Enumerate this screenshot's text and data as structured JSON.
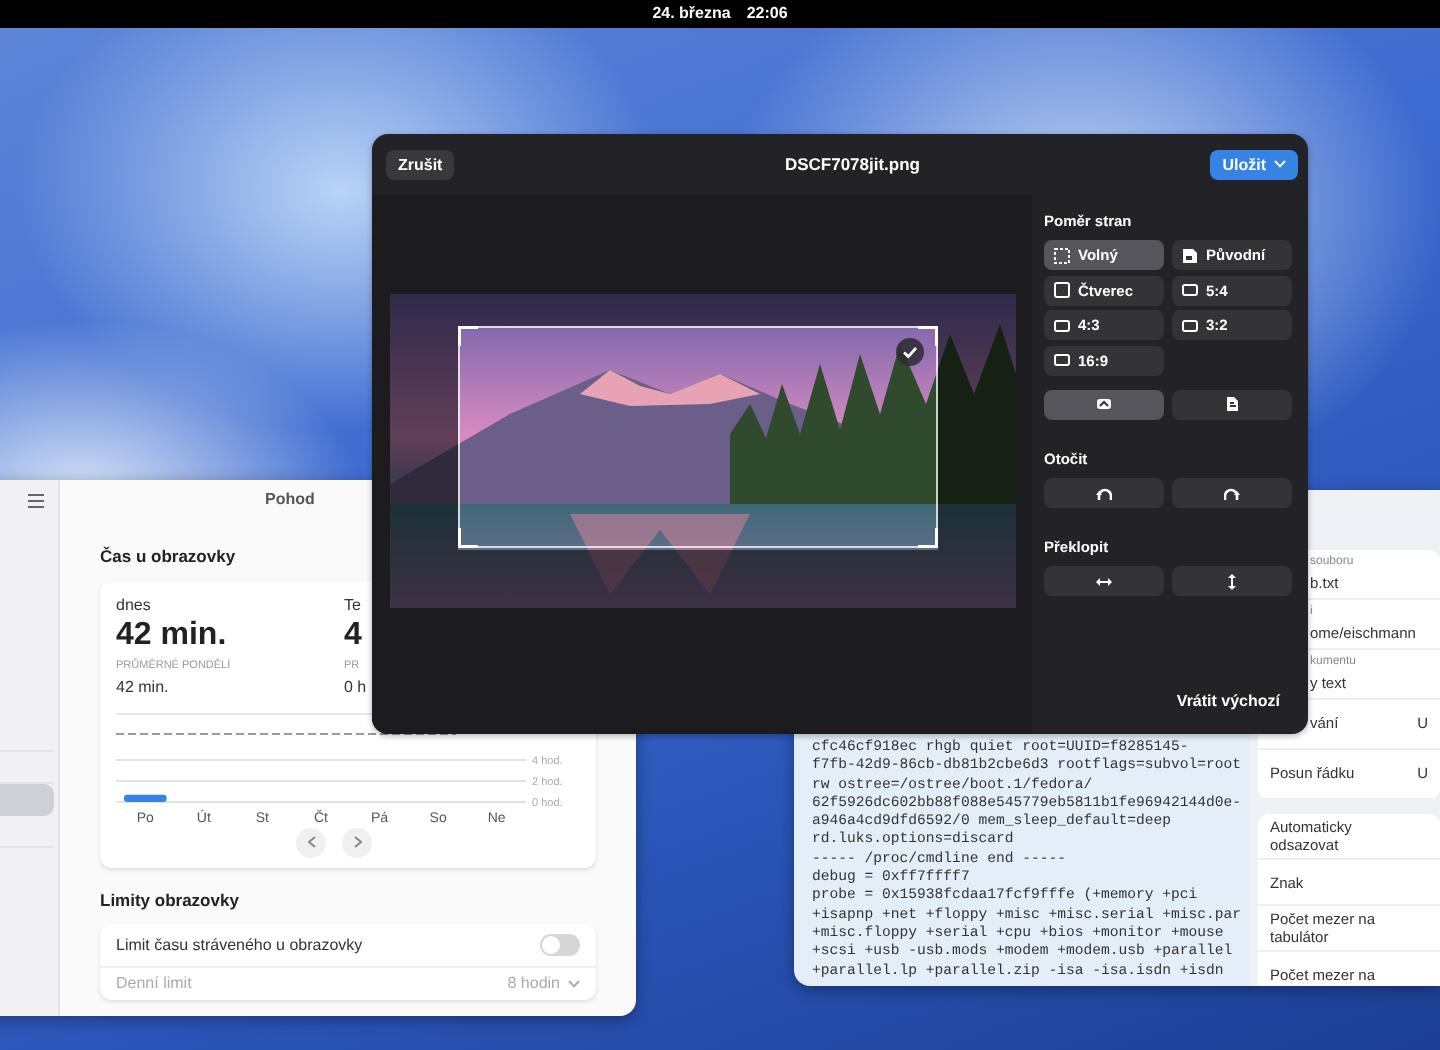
{
  "top_bar": {
    "date": "24. března",
    "time": "22:06"
  },
  "wellbeing_window": {
    "title": "Pohod",
    "sidebar_items": [
      {
        "selected": false
      },
      {
        "selected": false
      },
      {
        "selected": true
      },
      {
        "selected": false
      }
    ],
    "screen_time": {
      "heading": "Čas u obrazovky",
      "today_label": "dnes",
      "today_value": "42 min.",
      "avg_label": "PRŮMĚRNÉ PONDĚLÍ",
      "avg_value": "42 min.",
      "week_label": "Te",
      "week_value": "4",
      "week_avg_label": "PR",
      "week_avg_value": "0 h",
      "chart_data": {
        "type": "bar",
        "categories": [
          "Po",
          "Út",
          "St",
          "Čt",
          "Pá",
          "So",
          "Ne"
        ],
        "values": [
          0.7,
          0,
          0,
          0,
          0,
          0,
          0
        ],
        "ylim": [
          0,
          4
        ],
        "yticks": [
          {
            "value": 4,
            "label": "4 hod."
          },
          {
            "value": 2,
            "label": "2 hod."
          },
          {
            "value": 0,
            "label": "0 hod."
          }
        ]
      }
    },
    "limits": {
      "heading": "Limity obrazovky",
      "toggle_label": "Limit času stráveného u obrazovky",
      "toggle_on": false,
      "daily_label": "Denní limit",
      "daily_value": "8 hodin"
    }
  },
  "editor_window": {
    "text_lines": [
      "cfc46cf918ec rhgb quiet root=UUID=f8285145-",
      "f7fb-42d9-86cb-db81b2cbe6d3 rootflags=subvol=root",
      "rw ostree=/ostree/boot.1/fedora/",
      "62f5926dc602bb88f088e545779eb5811b1fe96942144d0e-",
      "a946a4cd9dfd6592/0 mem_sleep_default=deep",
      "rd.luks.options=discard",
      "----- /proc/cmdline end -----",
      "debug = 0xff7ffff7",
      "probe = 0x15938fcdaa17fcf9fffe (+memory +pci",
      "+isapnp +net +floppy +misc +misc.serial +misc.par",
      "+misc.floppy +serial +cpu +bios +monitor +mouse",
      "+scsi +usb -usb.mods +modem +modem.usb +parallel",
      "+parallel.lp +parallel.zip -isa -isa.isdn +isdn"
    ],
    "info": [
      {
        "kind": "field",
        "label": "souboru",
        "value": "b.txt"
      },
      {
        "kind": "field",
        "label": "i",
        "value": "ome/eischmann"
      },
      {
        "kind": "field",
        "label": "kumentu",
        "value": "y text"
      },
      {
        "kind": "row",
        "label": "vání",
        "value": "U"
      },
      {
        "kind": "row",
        "label": "Posun řádku",
        "value": "U"
      }
    ],
    "settings": [
      "Automaticky odsazovat",
      "Znak",
      "Počet mezer na tabulátor",
      "Počet mezer na"
    ]
  },
  "crop_dialog": {
    "cancel": "Zrušit",
    "title": "DSCF7078jit.png",
    "save": "Uložit",
    "aspect_heading": "Poměr stran",
    "aspects": [
      {
        "kind": "free",
        "label": "Volný",
        "selected": true
      },
      {
        "kind": "original",
        "label": "Původní",
        "selected": false
      },
      {
        "kind": "square",
        "label": "Čtverec",
        "selected": false
      },
      {
        "kind": "ratio",
        "label": "5:4",
        "selected": false
      },
      {
        "kind": "ratio",
        "label": "4:3",
        "selected": false
      },
      {
        "kind": "ratio",
        "label": "3:2",
        "selected": false
      },
      {
        "kind": "ratio",
        "label": "16:9",
        "selected": false
      }
    ],
    "orientations": [
      {
        "kind": "landscape",
        "selected": true
      },
      {
        "kind": "portrait",
        "selected": false
      }
    ],
    "rotate_heading": "Otočit",
    "flip_heading": "Překlopit",
    "reset": "Vrátit výchozí"
  }
}
